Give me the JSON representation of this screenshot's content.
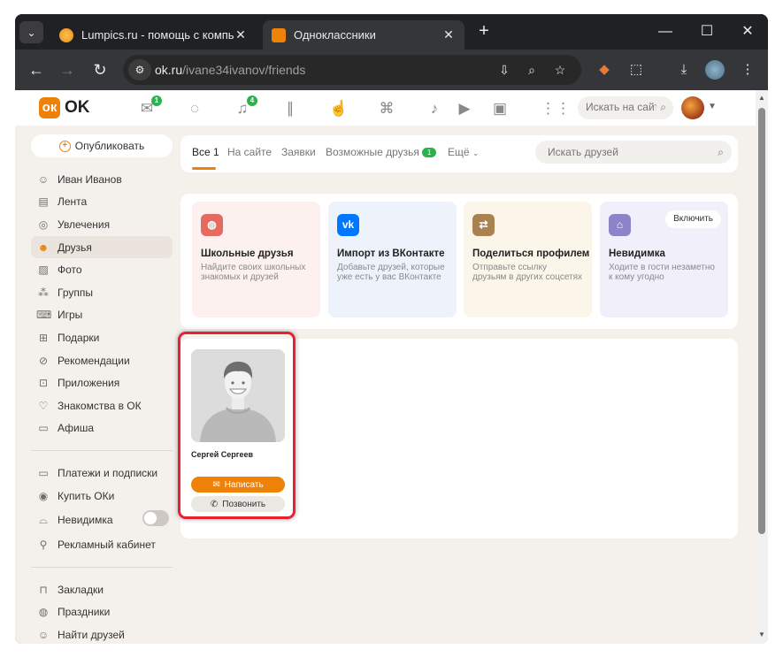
{
  "browser": {
    "tabs": [
      {
        "title": "Lumpics.ru - помощь с компьютером",
        "favicon": "lumpics-favicon",
        "active": false
      },
      {
        "title": "Одноклассники",
        "favicon": "ok-favicon",
        "active": true
      }
    ],
    "url_host": "ok.ru",
    "url_path": "/ivane34ivanov/friends",
    "icons": [
      "tab-search-icon",
      "back-icon",
      "forward-icon",
      "reload-icon",
      "site-info-icon",
      "install-icon",
      "zoom-icon",
      "bookmark-star-icon",
      "extension-fox-icon",
      "extensions-puzzle-icon",
      "download-icon",
      "profile-avatar-icon",
      "menu-kebab-icon"
    ]
  },
  "header": {
    "logo_text": "OK",
    "badges": {
      "messages": "1",
      "notifications": "4"
    },
    "search_placeholder": "Искать на сайте"
  },
  "sidebar": {
    "publish_label": "Опубликовать",
    "items": [
      {
        "label": "Иван Иванов",
        "icon": "user-icon"
      },
      {
        "label": "Лента",
        "icon": "feed-icon"
      },
      {
        "label": "Увлечения",
        "icon": "hobby-icon"
      },
      {
        "label": "Друзья",
        "icon": "friends-icon",
        "active": true
      },
      {
        "label": "Фото",
        "icon": "photo-icon"
      },
      {
        "label": "Группы",
        "icon": "groups-icon"
      },
      {
        "label": "Игры",
        "icon": "games-icon"
      },
      {
        "label": "Подарки",
        "icon": "gift-icon"
      },
      {
        "label": "Рекомендации",
        "icon": "recommend-icon"
      },
      {
        "label": "Приложения",
        "icon": "apps-icon"
      },
      {
        "label": "Знакомства в ОК",
        "icon": "dating-icon"
      },
      {
        "label": "Афиша",
        "icon": "tickets-icon"
      }
    ],
    "items2": [
      {
        "label": "Платежи и подписки",
        "icon": "card-icon"
      },
      {
        "label": "Купить ОКи",
        "icon": "coin-icon"
      },
      {
        "label": "Невидимка",
        "icon": "invisible-icon",
        "toggle": false
      },
      {
        "label": "Рекламный кабинет",
        "icon": "ads-icon"
      }
    ],
    "items3": [
      {
        "label": "Закладки",
        "icon": "bookmark-icon"
      },
      {
        "label": "Праздники",
        "icon": "holiday-icon"
      },
      {
        "label": "Найти друзей",
        "icon": "find-friends-icon"
      }
    ]
  },
  "friends_tabs": [
    {
      "label": "Все 1",
      "active": true
    },
    {
      "label": "На сайте"
    },
    {
      "label": "Заявки"
    },
    {
      "label": "Возможные друзья",
      "badge": "1"
    },
    {
      "label": "Ещё"
    }
  ],
  "friends_search_placeholder": "Искать друзей",
  "promos": [
    {
      "title": "Школьные друзья",
      "desc": "Найдите своих школьных знакомых и друзей",
      "color": "#e56a5f",
      "bg": "#fdf1ef",
      "icon": "globe-icon"
    },
    {
      "title": "Импорт из ВКонтакте",
      "desc": "Добавьте друзей, которые уже есть у вас ВКонтакте",
      "color": "#0077ff",
      "bg": "#eef3fb",
      "icon": "vk-icon"
    },
    {
      "title": "Поделиться профилем",
      "desc": "Отправьте ссылку друзьям в других соцсетях",
      "color": "#a98250",
      "bg": "#fbf5ea",
      "icon": "share-icon"
    },
    {
      "title": "Невидимка",
      "desc": "Ходите в гости незаметно к кому угодно",
      "color": "#8c84c9",
      "bg": "#f1effa",
      "icon": "hat-icon",
      "button": "Включить"
    }
  ],
  "friend": {
    "name": "Сергей Сергеев",
    "write_label": "Написать",
    "call_label": "Позвонить"
  }
}
